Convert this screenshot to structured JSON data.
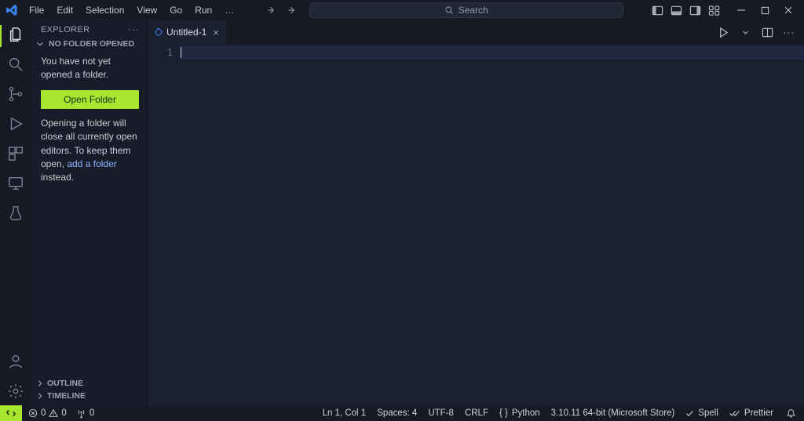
{
  "menu": {
    "items": [
      "File",
      "Edit",
      "Selection",
      "View",
      "Go",
      "Run"
    ],
    "more": "…"
  },
  "search": {
    "placeholder": "Search"
  },
  "sidebar": {
    "title": "EXPLORER",
    "section_no_folder": "NO FOLDER OPENED",
    "no_folder_msg": "You have not yet opened a folder.",
    "open_folder_label": "Open Folder",
    "help_pre": "Opening a folder will close all currently open editors. To keep them open, ",
    "help_link": "add a folder",
    "help_post": " instead.",
    "outline": "OUTLINE",
    "timeline": "TIMELINE"
  },
  "tabs": {
    "t0": {
      "label": "Untitled-1"
    }
  },
  "gutter": {
    "line1": "1"
  },
  "status": {
    "errors": "0",
    "warnings": "0",
    "ports": "0",
    "cursor": "Ln 1, Col 1",
    "spaces": "Spaces: 4",
    "encoding": "UTF-8",
    "eol": "CRLF",
    "lang": "Python",
    "interpreter": "3.10.11 64-bit (Microsoft Store)",
    "spell": "Spell",
    "prettier": "Prettier"
  }
}
